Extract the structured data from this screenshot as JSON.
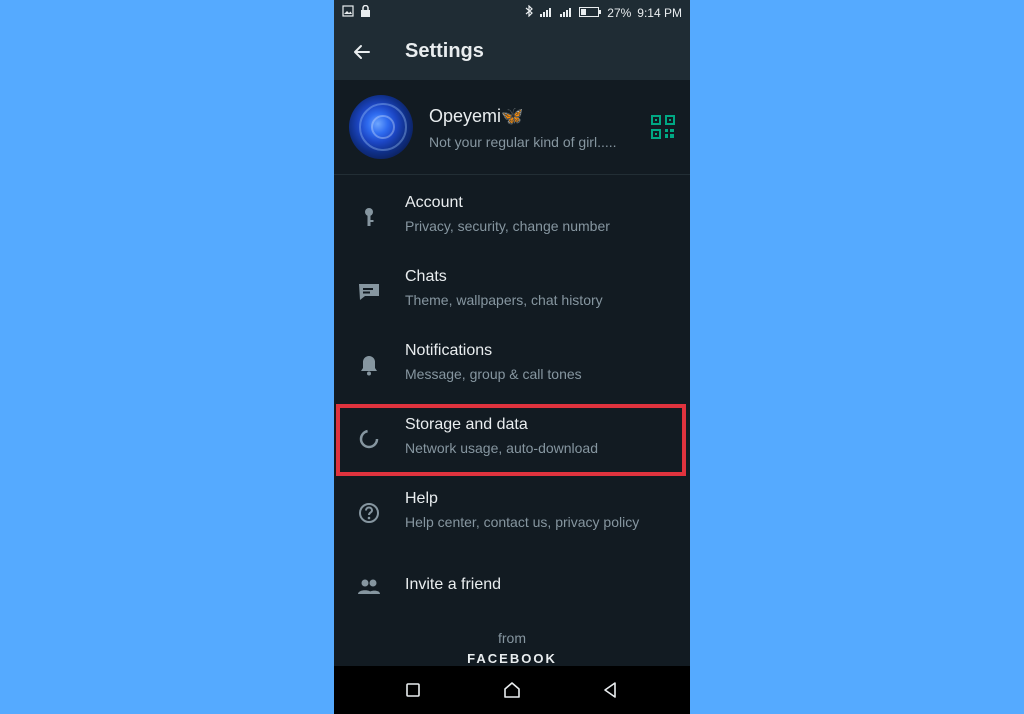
{
  "status_bar": {
    "battery": "27%",
    "time": "9:14 PM"
  },
  "app_bar": {
    "title": "Settings"
  },
  "profile": {
    "name": "Opeyemi🦋",
    "status": "Not your regular kind of girl....."
  },
  "menu": [
    {
      "title": "Account",
      "subtitle": "Privacy, security, change number",
      "icon": "key-icon"
    },
    {
      "title": "Chats",
      "subtitle": "Theme, wallpapers, chat history",
      "icon": "chat-icon"
    },
    {
      "title": "Notifications",
      "subtitle": "Message, group & call tones",
      "icon": "bell-icon"
    },
    {
      "title": "Storage and data",
      "subtitle": "Network usage, auto-download",
      "icon": "storage-icon"
    },
    {
      "title": "Help",
      "subtitle": "Help center, contact us, privacy policy",
      "icon": "help-icon"
    },
    {
      "title": "Invite a friend",
      "subtitle": "",
      "icon": "people-icon"
    }
  ],
  "footer": {
    "from": "from",
    "brand": "FACEBOOK"
  },
  "colors": {
    "page_bg": "#55aaff",
    "app_bg": "#121b22",
    "bar_bg": "#1f2c34",
    "accent": "#00a884",
    "highlight": "#e0333e"
  }
}
